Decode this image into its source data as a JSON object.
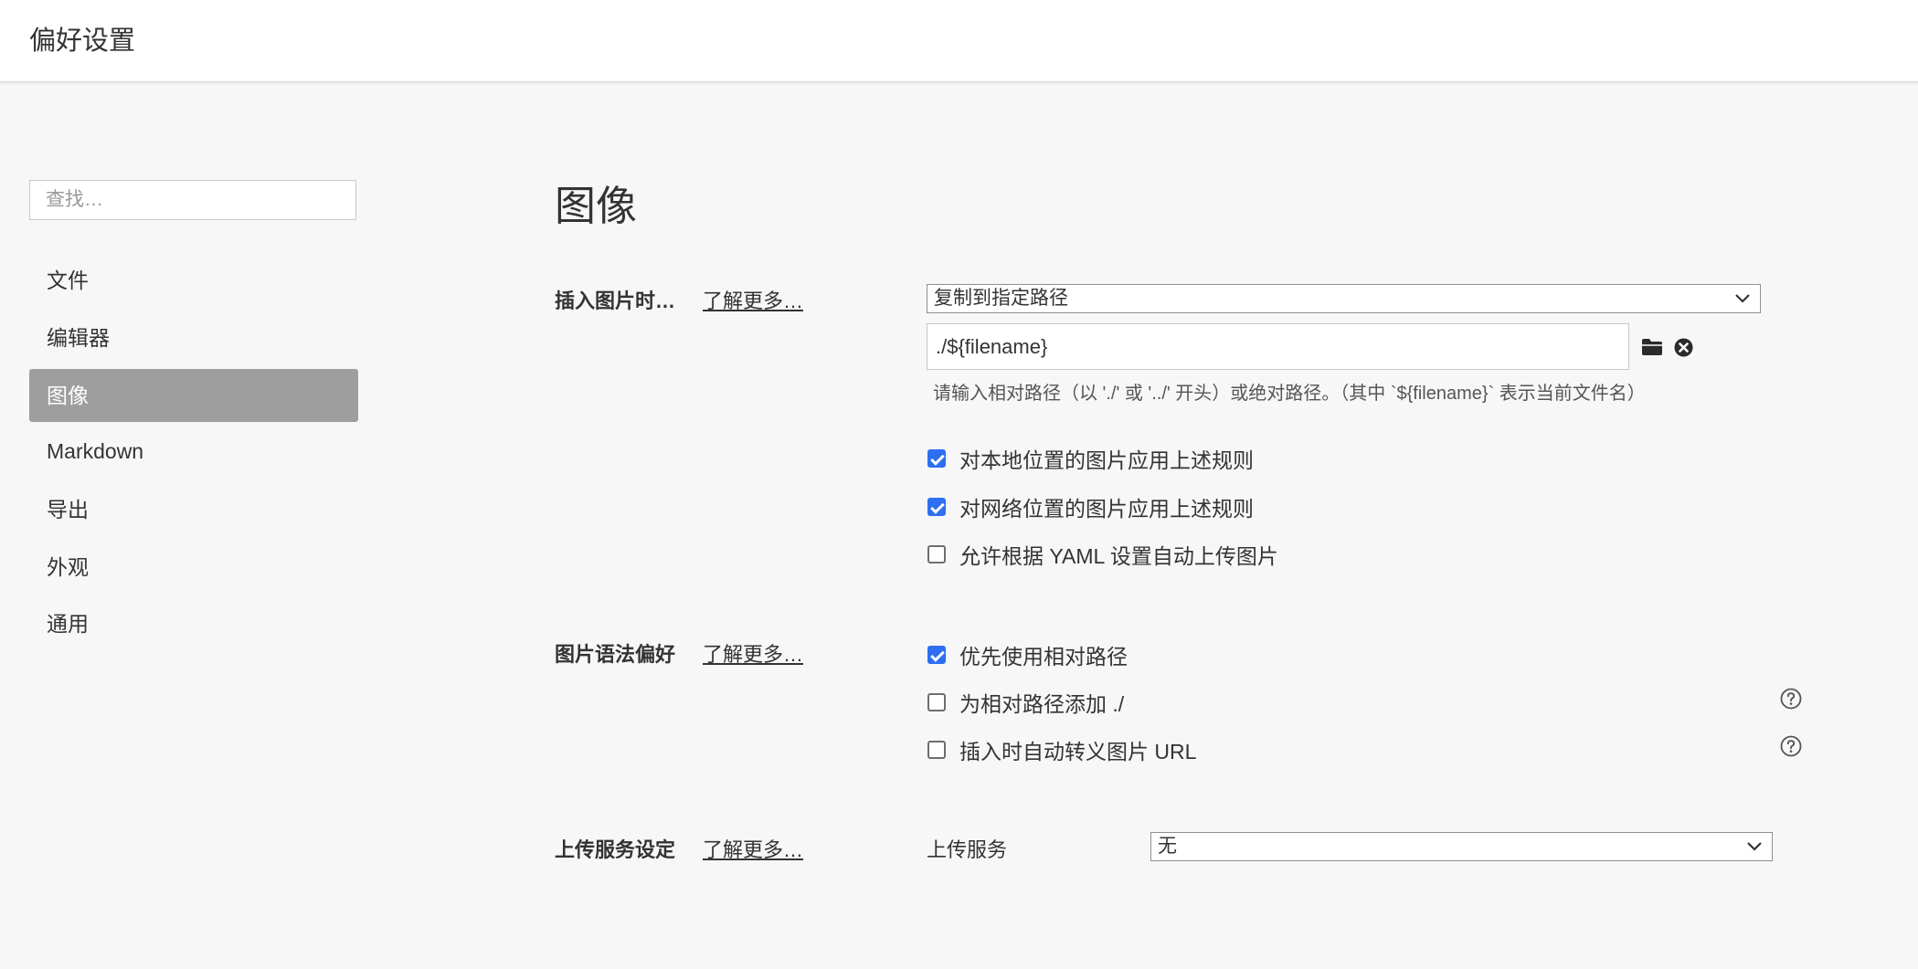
{
  "window": {
    "title": "偏好设置"
  },
  "sidebar": {
    "search_placeholder": "查找…",
    "items": [
      {
        "label": "文件",
        "active": false
      },
      {
        "label": "编辑器",
        "active": false
      },
      {
        "label": "图像",
        "active": true
      },
      {
        "label": "Markdown",
        "active": false
      },
      {
        "label": "导出",
        "active": false
      },
      {
        "label": "外观",
        "active": false
      },
      {
        "label": "通用",
        "active": false
      }
    ]
  },
  "main": {
    "heading": "图像",
    "insert_section": {
      "label": "插入图片时…",
      "learn_more": "了解更多…",
      "action_select": "复制到指定路径",
      "path_value": "./${filename}",
      "hint": "请输入相对路径（以 './' 或 '../' 开头）或绝对路径。（其中 `${filename}` 表示当前文件名）",
      "options": [
        {
          "label": "对本地位置的图片应用上述规则",
          "checked": true
        },
        {
          "label": "对网络位置的图片应用上述规则",
          "checked": true
        },
        {
          "label": "允许根据 YAML 设置自动上传图片",
          "checked": false
        }
      ]
    },
    "syntax_section": {
      "label": "图片语法偏好",
      "learn_more": "了解更多…",
      "options": [
        {
          "label": "优先使用相对路径",
          "checked": true
        },
        {
          "label": "为相对路径添加 ./",
          "checked": false
        },
        {
          "label": "插入时自动转义图片 URL",
          "checked": false
        }
      ]
    },
    "upload_section": {
      "label": "上传服务设定",
      "learn_more": "了解更多…",
      "service_label": "上传服务",
      "service_value": "无"
    }
  },
  "colors": {
    "accent": "#2d6ff0",
    "active_nav_bg": "#9e9e9e",
    "background": "#f7f7f7"
  },
  "icons": [
    "folder-icon",
    "clear-icon",
    "help-icon",
    "chevron-down-icon"
  ]
}
